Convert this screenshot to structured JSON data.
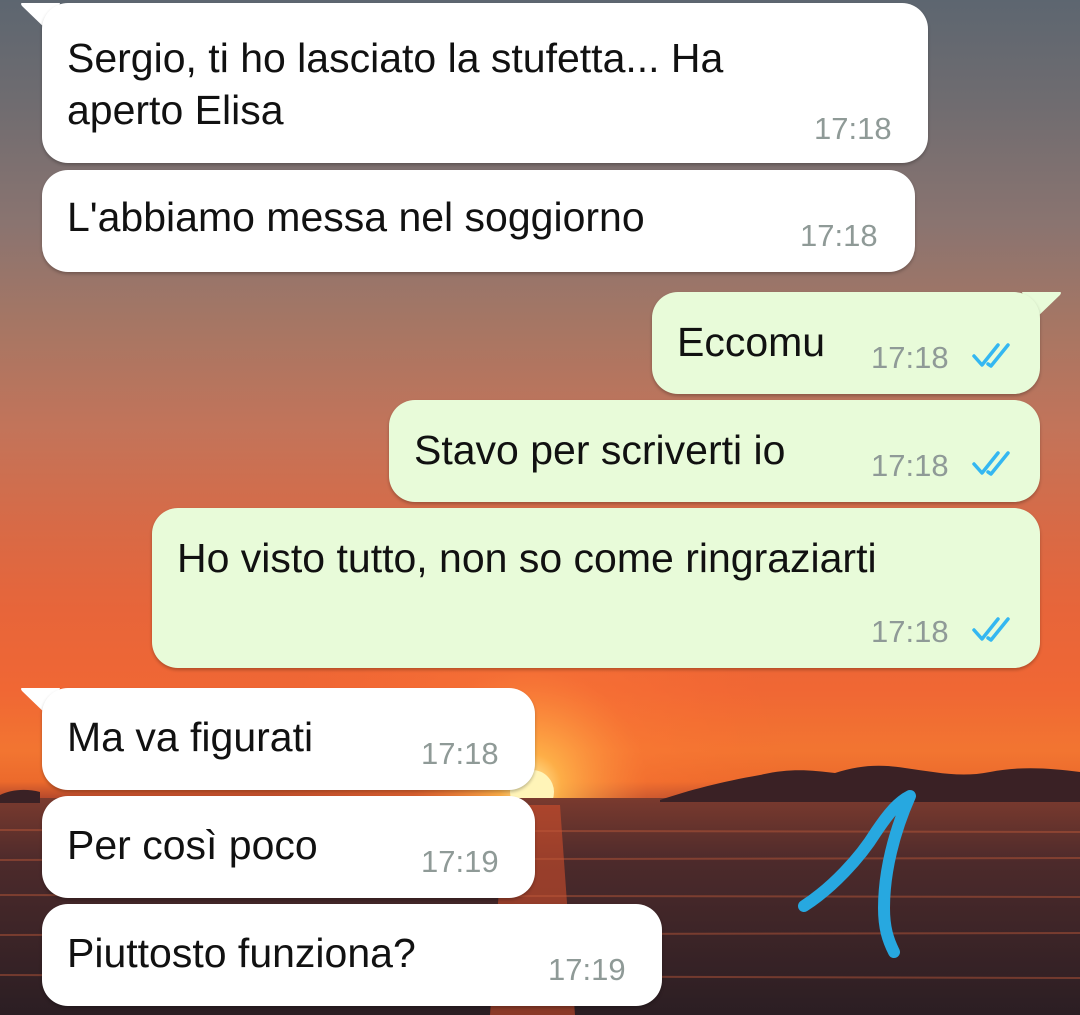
{
  "chat": {
    "messages": [
      {
        "direction": "incoming",
        "lines": [
          "Sergio, ti ho lasciato la stufetta... Ha",
          "aperto Elisa"
        ],
        "time": "17:18"
      },
      {
        "direction": "incoming",
        "lines": [
          "L'abbiamo messa nel soggiorno"
        ],
        "time": "17:18"
      },
      {
        "direction": "outgoing",
        "lines": [
          "Eccomu"
        ],
        "time": "17:18",
        "status": "read"
      },
      {
        "direction": "outgoing",
        "lines": [
          "Stavo per scriverti io"
        ],
        "time": "17:18",
        "status": "read"
      },
      {
        "direction": "outgoing",
        "lines": [
          "Ho visto tutto, non so come ringraziarti"
        ],
        "time": "17:18",
        "status": "read"
      },
      {
        "direction": "incoming",
        "lines": [
          "Ma va figurati"
        ],
        "time": "17:18"
      },
      {
        "direction": "incoming",
        "lines": [
          "Per così poco"
        ],
        "time": "17:19"
      },
      {
        "direction": "incoming",
        "lines": [
          "Piuttosto funziona?"
        ],
        "time": "17:19"
      }
    ]
  },
  "colors": {
    "incoming_bubble": "#ffffff",
    "outgoing_bubble": "#e8fbd9",
    "read_ticks": "#34b7f1",
    "annotation_stroke": "#27a8e0"
  },
  "icons": {
    "read_receipt": "double-check-icon",
    "wallpaper": "sunset-sea-wallpaper",
    "annotation": "hand-drawn-number-one"
  }
}
